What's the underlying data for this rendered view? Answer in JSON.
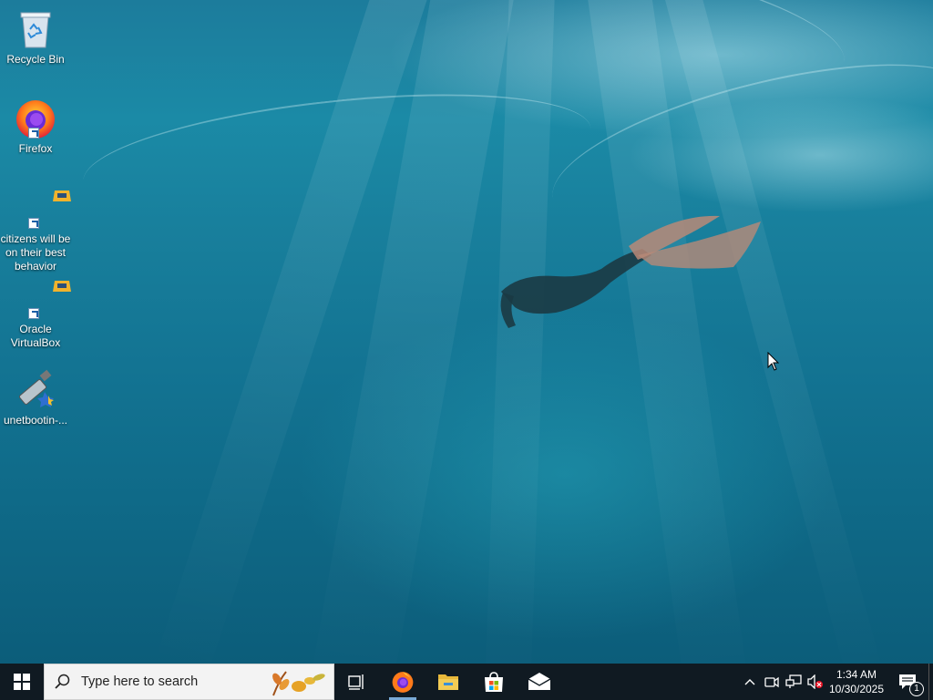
{
  "desktop": {
    "icons": [
      {
        "label": "Recycle Bin"
      },
      {
        "label": "Firefox"
      },
      {
        "label": "citizens will be on their best behavior"
      },
      {
        "label": "Oracle VirtualBox"
      },
      {
        "label": "unetbootin-..."
      }
    ]
  },
  "taskbar": {
    "search_placeholder": "Type here to search",
    "pinned": [
      "Task View",
      "Firefox",
      "File Explorer",
      "Microsoft Store",
      "Mail"
    ]
  },
  "tray": {
    "time": "1:34 AM",
    "date": "10/30/2025",
    "notification_count": "1"
  },
  "colors": {
    "taskbar": "#101a22",
    "accent": "#7aaad6",
    "folder": "#e8b83a",
    "vbox": "#f0b32d"
  }
}
